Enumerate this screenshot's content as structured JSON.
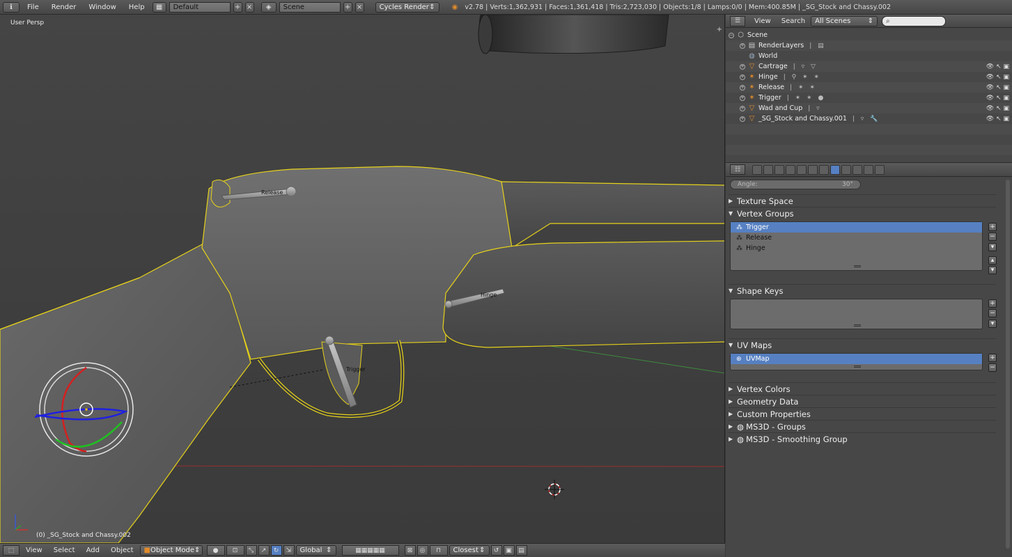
{
  "topbar": {
    "menus": [
      "File",
      "Render",
      "Window",
      "Help"
    ],
    "layout_value": "Default",
    "scene_value": "Scene",
    "engine_value": "Cycles Render",
    "stats": "v2.78 | Verts:1,362,931 | Faces:1,361,418 | Tris:2,723,030 | Objects:1/8 | Lamps:0/0 | Mem:400.85M | _SG_Stock and Chassy.002"
  },
  "viewport": {
    "view_name": "User Persp",
    "object_info": "(0) _SG_Stock and Chassy.002",
    "labels": {
      "release": "Release",
      "hinge": "Hinge",
      "trigger": "Trigger"
    }
  },
  "vp_header": {
    "menus": [
      "View",
      "Select",
      "Add",
      "Object"
    ],
    "mode_value": "Object Mode",
    "orientation_value": "Global",
    "snap_value": "Closest"
  },
  "outliner": {
    "menus": [
      "View",
      "Search"
    ],
    "filter_value": "All Scenes",
    "rows": [
      {
        "name": "Scene",
        "icon": "scene-icon",
        "indent": 0
      },
      {
        "name": "RenderLayers",
        "icon": "renderlayers-icon",
        "indent": 1
      },
      {
        "name": "World",
        "icon": "world-icon",
        "indent": 1
      },
      {
        "name": "Cartrage",
        "icon": "mesh-icon",
        "indent": 1
      },
      {
        "name": "Hinge",
        "icon": "armature-icon",
        "indent": 1
      },
      {
        "name": "Release",
        "icon": "armature-icon",
        "indent": 1
      },
      {
        "name": "Trigger",
        "icon": "armature-icon",
        "indent": 1
      },
      {
        "name": "Wad and Cup",
        "icon": "mesh-icon",
        "indent": 1
      },
      {
        "name": "_SG_Stock and Chassy.001",
        "icon": "mesh-icon",
        "indent": 1
      }
    ]
  },
  "properties": {
    "angle_label": "Angle:",
    "angle_value": "30°",
    "sections": {
      "texture_space": "Texture Space",
      "vertex_groups": "Vertex Groups",
      "shape_keys": "Shape Keys",
      "uv_maps": "UV Maps",
      "vertex_colors": "Vertex Colors",
      "geometry_data": "Geometry Data",
      "custom_properties": "Custom Properties",
      "ms3d_groups": "MS3D - Groups",
      "ms3d_smoothing": "MS3D - Smoothing Group"
    },
    "vertex_groups": [
      "Trigger",
      "Release",
      "Hinge"
    ],
    "uv_maps": [
      "UVMap"
    ]
  },
  "colors": {
    "accent": "#5680c2",
    "selection_outline": "#e6d21a",
    "x_axis": "#c83232",
    "y_axis": "#32c832",
    "z_axis": "#3232d2"
  }
}
